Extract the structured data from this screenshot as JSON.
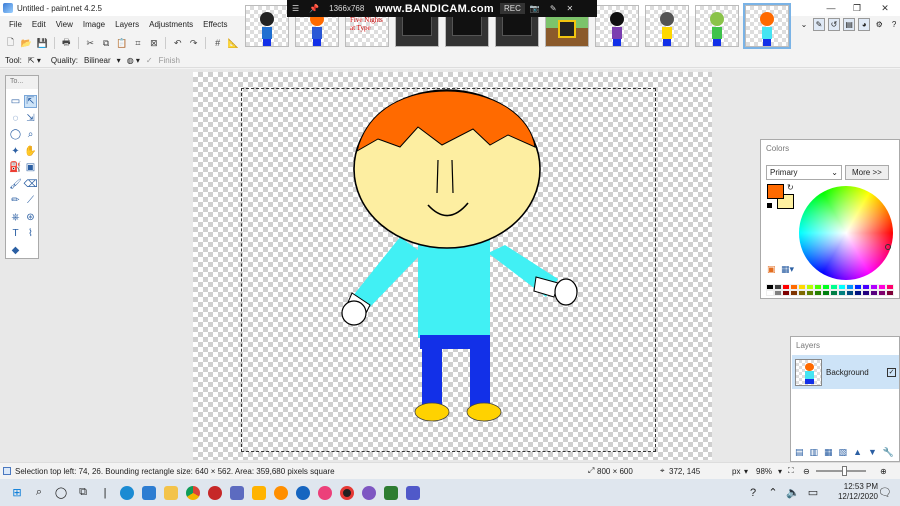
{
  "window": {
    "title": "Untitled - paint.net 4.2.5"
  },
  "menu": [
    "File",
    "Edit",
    "View",
    "Image",
    "Layers",
    "Adjustments",
    "Effects"
  ],
  "recorder": {
    "resolution": "1366x768",
    "brand": "www.BANDICAM.com",
    "rec": "REC"
  },
  "tab_thumbs": [
    {
      "kind": "char",
      "hair": "#222222",
      "body": "#1f6fd1"
    },
    {
      "kind": "char",
      "hair": "#ff6a00",
      "body": "#2a58d6"
    },
    {
      "kind": "text",
      "text": "Five Nights at Type"
    },
    {
      "kind": "screen"
    },
    {
      "kind": "screen"
    },
    {
      "kind": "screen"
    },
    {
      "kind": "scene"
    },
    {
      "kind": "char",
      "hair": "#111111",
      "body": "#7b3fb0"
    },
    {
      "kind": "char",
      "hair": "#555555",
      "body": "#ffd800"
    },
    {
      "kind": "char",
      "hair": "#8bc34a",
      "body": "#3ec24a"
    },
    {
      "kind": "char",
      "hair": "#ff6a00",
      "body": "#45e4f2",
      "selected": true
    }
  ],
  "options": {
    "tool_label": "Tool:",
    "quality_label": "Quality:",
    "quality_value": "Bilinear",
    "finish_label": "Finish"
  },
  "tools_panel": {
    "header": "To..."
  },
  "colors_panel": {
    "header": "Colors",
    "mode": "Primary",
    "more_button": "More >>",
    "primary_color": "#ff6a00",
    "secondary_color": "#fef0a0"
  },
  "layers_panel": {
    "header": "Layers",
    "layer_name": "Background",
    "visible_mark": "✓"
  },
  "status": {
    "selection_text": "Selection top left: 74, 26. Bounding rectangle size: 640 × 562. Area: 359,680 pixels square",
    "image_size": "800 × 600",
    "cursor_pos": "372, 145",
    "units": "px",
    "zoom": "98%"
  },
  "taskbar": {
    "time": "12:53 PM",
    "date": "12/12/2020"
  },
  "colors": {
    "hair": "#ff6a00",
    "skin": "#fdeea1",
    "shirt": "#41f0f4",
    "pants": "#1230e8",
    "shoes": "#ffd200",
    "accent": "#2b5fa3"
  }
}
